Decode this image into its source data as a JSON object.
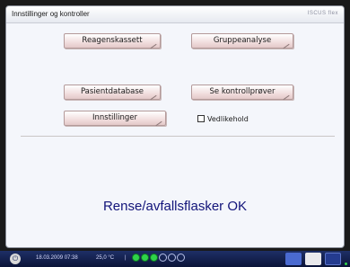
{
  "window": {
    "title": "Innstillinger og kontroller",
    "brand": "ISCUS flex"
  },
  "buttons": {
    "reagent_cassette": "Reagenskassett",
    "group_analysis": "Gruppeanalyse",
    "patient_database": "Pasientdatabase",
    "view_control_samples": "Se kontrollprøver",
    "settings": "Innstillinger"
  },
  "maintenance": {
    "label": "Vedlikehold",
    "checked": false
  },
  "status": {
    "message": "Rense/avfallsflasker OK"
  },
  "taskbar": {
    "datetime": "18.03.2009 07:38",
    "temperature": "25,0 °C",
    "separator": "|",
    "dots_on": 3,
    "dots_total": 6,
    "icons": [
      "power-icon",
      "keyboard-icon",
      "gear-icon",
      "folder-icon"
    ]
  }
}
